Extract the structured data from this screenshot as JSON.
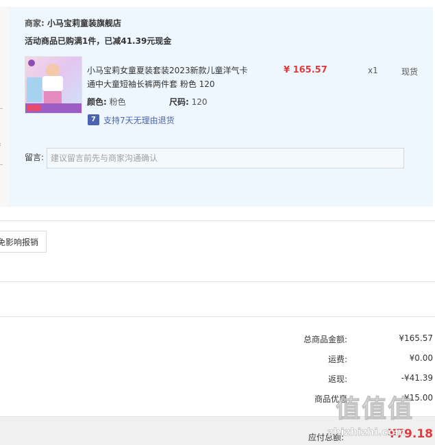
{
  "shop": {
    "merchant_label": "商家:",
    "merchant_name": "小马宝莉童装旗舰店",
    "promo_text": "活动商品已购满1件，已减41.39元现金"
  },
  "item": {
    "title": "小马宝莉女童夏装套装2023新款儿童洋气卡通中大童短袖长裤两件套 粉色 120",
    "price": "¥ 165.57",
    "quantity": "x1",
    "stock_status": "现货",
    "color_label": "颜色:",
    "color_value": "粉色",
    "size_label": "尺码:",
    "size_value": "120",
    "return_icon_text": "7",
    "return_policy": "支持7天无理由退货"
  },
  "note": {
    "label": "留言:",
    "placeholder": "建议留言前先与商家沟通确认"
  },
  "invoice_button_label": "免影响报销",
  "summary": {
    "rows": [
      {
        "label": "总商品金额:",
        "value": "¥165.57"
      },
      {
        "label": "运费:",
        "value": "¥0.00"
      },
      {
        "label": "返现:",
        "value": "-¥41.39"
      },
      {
        "label": "商品优惠",
        "value": "¥15.00"
      }
    ],
    "payable_label": "应付总额:",
    "payable_value": "¥79.18"
  },
  "watermark": {
    "main": "值值值",
    "sub": "zhizhizhi.com"
  },
  "colors": {
    "accent_red": "#e4393c",
    "panel_bg": "#eef7fd",
    "return_blue": "#4b63b3"
  }
}
